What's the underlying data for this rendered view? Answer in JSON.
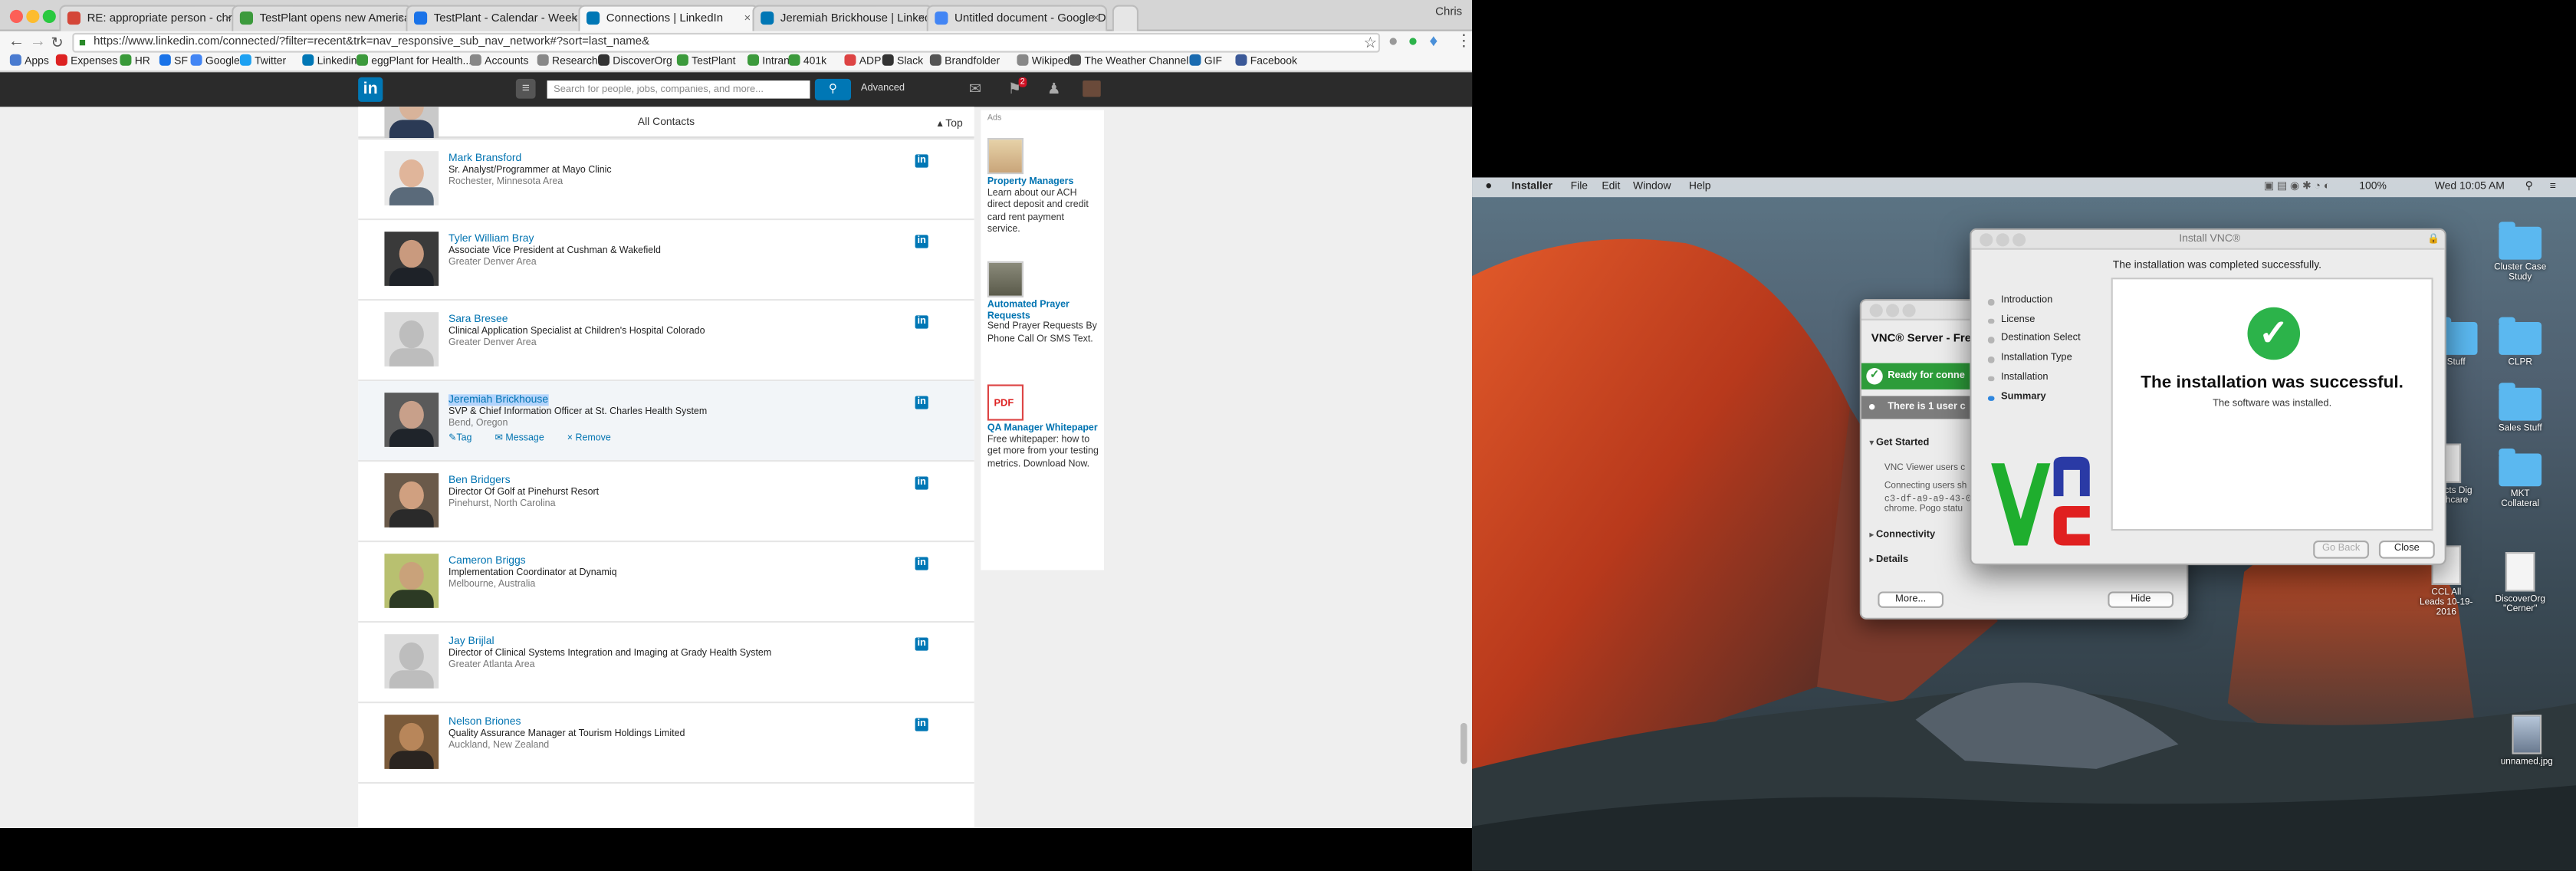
{
  "chrome": {
    "tabs": [
      {
        "label": "RE: appropriate person - chris",
        "fav_color": "#d44638"
      },
      {
        "label": "TestPlant opens new Americas",
        "fav_color": "#3c9a3c"
      },
      {
        "label": "TestPlant - Calendar - Week of",
        "fav_color": "#1a73e8"
      },
      {
        "label": "Connections | LinkedIn",
        "fav_color": "#0077b5"
      },
      {
        "label": "Jeremiah Brickhouse | LinkedIn",
        "fav_color": "#0077b5"
      },
      {
        "label": "Untitled document - Google Do",
        "fav_color": "#4285f4"
      }
    ],
    "profile_name": "Chris",
    "url": "https://www.linkedin.com/connected/?filter=recent&trk=nav_responsive_sub_nav_network#?sort=last_name&",
    "bookmarks": [
      "Apps",
      "Expenses",
      "HR",
      "SF",
      "Google",
      "Twitter",
      "Linkedin",
      "eggPlant for Health...",
      "Accounts",
      "Research",
      "DiscoverOrg",
      "TestPlant",
      "Intranet",
      "401k",
      "ADP",
      "Slack",
      "Brandfolder",
      "Wikipedia",
      "The Weather Channel",
      "GIF",
      "Facebook"
    ]
  },
  "linkedin": {
    "logo": "in",
    "search_placeholder": "Search for people, jobs, companies, and more...",
    "advanced_label": "Advanced",
    "flag_badge": "2",
    "all_contacts": "All Contacts",
    "top_link": "Top",
    "contacts": [
      {
        "name": "Mark Bransford",
        "title": "Sr. Analyst/Programmer at Mayo Clinic",
        "location": "Rochester, Minnesota Area"
      },
      {
        "name": "Tyler William Bray",
        "title": "Associate Vice President at Cushman & Wakefield",
        "location": "Greater Denver Area"
      },
      {
        "name": "Sara Bresee",
        "title": "Clinical Application Specialist at Children's Hospital Colorado",
        "location": "Greater Denver Area"
      },
      {
        "name": "Jeremiah Brickhouse",
        "title": "SVP & Chief Information Officer at St. Charles Health System",
        "location": "Bend, Oregon"
      },
      {
        "name": "Ben Bridgers",
        "title": "Director Of Golf at Pinehurst Resort",
        "location": "Pinehurst, North Carolina"
      },
      {
        "name": "Cameron Briggs",
        "title": "Implementation Coordinator at Dynamiq",
        "location": "Melbourne, Australia"
      },
      {
        "name": "Jay Brijlal",
        "title": "Director of Clinical Systems Integration and Imaging at Grady Health System",
        "location": "Greater Atlanta Area"
      },
      {
        "name": "Nelson Briones",
        "title": "Quality Assurance Manager at Tourism Holdings Limited",
        "location": "Auckland, New Zealand"
      }
    ],
    "actions": {
      "tag": "Tag",
      "message": "Message",
      "remove": "Remove"
    },
    "ads": {
      "header": "Ads",
      "items": [
        {
          "title": "Property Managers",
          "text": "Learn about our ACH direct deposit and credit card rent payment service."
        },
        {
          "title": "Automated Prayer Requests",
          "text": "Send Prayer Requests By Phone Call Or SMS Text."
        },
        {
          "title": "QA Manager Whitepaper",
          "text": "Free whitepaper: how to get more from your testing metrics. Download Now."
        }
      ]
    }
  },
  "mac": {
    "menubar": {
      "app": "Installer",
      "items": [
        "File",
        "Edit",
        "Window",
        "Help"
      ],
      "battery": "100%",
      "clock": "Wed 10:05 AM"
    },
    "desktop_icons": [
      "Cluster Case Study",
      "Stuff",
      "CLPR",
      "Sales Stuff",
      "Contacts Dig Healthcare",
      "MKT Collateral",
      "CCL All Leads 10-19-2016",
      "DiscoverOrg \"Cerner\"",
      "unnamed.jpg"
    ],
    "vnc_server": {
      "heading": "VNC® Server - Free",
      "ready": "Ready for conne",
      "users": "There is 1 user c",
      "get_started": "Get Started",
      "viewer_line": "VNC Viewer users c",
      "connecting_1": "Connecting users sh",
      "connecting_2": "c3-df-a9-a9-43-0",
      "connecting_3": "chrome. Pogo statu",
      "connectivity": "Connectivity",
      "details": "Details",
      "more_button": "More...",
      "hide_button": "Hide"
    },
    "installer": {
      "title": "Install VNC®",
      "completed_msg": "The installation was completed successfully.",
      "steps": [
        "Introduction",
        "License",
        "Destination Select",
        "Installation Type",
        "Installation",
        "Summary"
      ],
      "success_heading": "The installation was successful.",
      "success_sub": "The software was installed.",
      "go_back": "Go Back",
      "close": "Close"
    }
  }
}
